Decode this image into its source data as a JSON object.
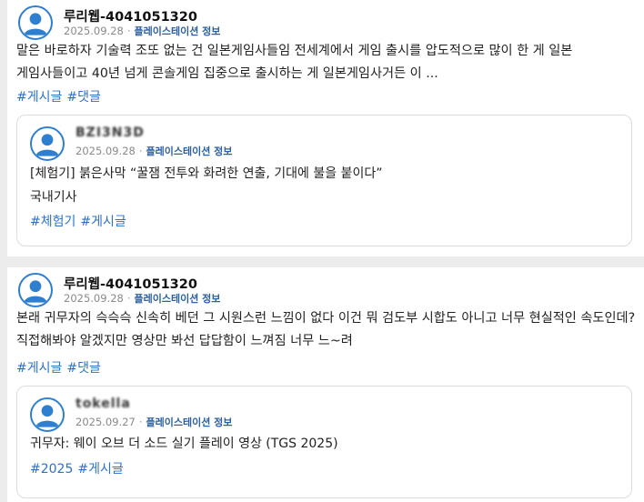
{
  "posts": [
    {
      "author": "루리웹-4041051320",
      "date": "2025.09.28",
      "separator": "·",
      "source": "플레이스테이션 정보",
      "body": "말은 바로하자 기술력 조또 없는 건 일본게임사들임 전세계에서 게임 출시를 압도적으로 많이 한 게 일본 게임사들이고 40년 넘게 콘솔게임 집중으로 출시하는 게 일본게임사거든 이 ...",
      "tags": [
        "#게시글",
        "#댓글"
      ],
      "quoted": {
        "author": "BZI3N3D",
        "date": "2025.09.28",
        "separator": "·",
        "source": "플레이스테이션 정보",
        "title": "[체험기] 붉은사막 “꿀잼 전투와 화려한 연출, 기대에 불을 붙이다”",
        "subtitle": "국내기사",
        "tags": [
          "#체험기",
          "#게시글"
        ]
      }
    },
    {
      "author": "루리웹-4041051320",
      "date": "2025.09.28",
      "separator": "·",
      "source": "플레이스테이션 정보",
      "body": "본래 귀무자의 슥슥슥 신속히 베던 그 시원스런 느낌이 없다 이건 뭐 검도부 시합도 아니고 너무 현실적인 속도인데? 직접해봐야 알겠지만 영상만 봐선 답답함이 느껴짐 너무 느~려",
      "tags": [
        "#게시글",
        "#댓글"
      ],
      "quoted": {
        "author": "tokella",
        "date": "2025.09.27",
        "separator": "·",
        "source": "플레이스테이션 정보",
        "title": "귀무자: 웨이 오브 더 소드 실기 플레이 영상 (TGS 2025)",
        "tags": [
          "#2025",
          "#게시글"
        ]
      }
    }
  ],
  "icons": {
    "avatar": "user-avatar-icon"
  },
  "colors": {
    "accent": "#2f7fd0",
    "tag": "#2d72c8",
    "source": "#2a5fa0",
    "background": "#ececec"
  }
}
